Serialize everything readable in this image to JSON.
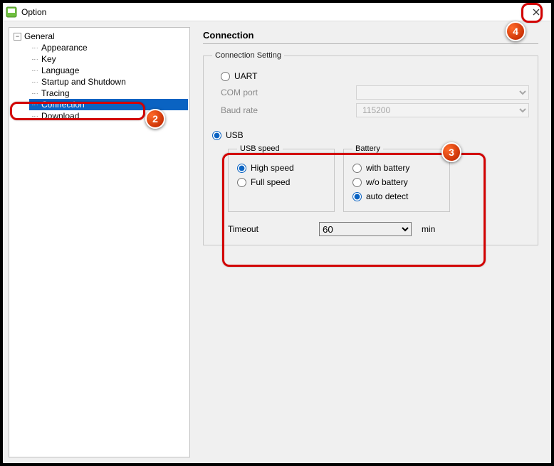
{
  "window": {
    "title": "Option"
  },
  "tree": {
    "root": "General",
    "items": [
      "Appearance",
      "Key",
      "Language",
      "Startup and Shutdown",
      "Tracing",
      "Connection",
      "Download"
    ],
    "selected": "Connection"
  },
  "page": {
    "heading": "Connection",
    "group_label": "Connection Setting",
    "uart": {
      "label": "UART",
      "com_label": "COM port",
      "com_value": "",
      "baud_label": "Baud rate",
      "baud_value": "115200"
    },
    "usb": {
      "label": "USB",
      "speed_group": "USB speed",
      "speed_options": {
        "high": "High speed",
        "full": "Full speed"
      },
      "speed_selected": "high",
      "battery_group": "Battery",
      "battery_options": {
        "with": "with battery",
        "without": "w/o battery",
        "auto": "auto detect"
      },
      "battery_selected": "auto",
      "timeout_label": "Timeout",
      "timeout_value": "60",
      "timeout_unit": "min"
    }
  },
  "annotations": {
    "b2": "2",
    "b3": "3",
    "b4": "4"
  }
}
